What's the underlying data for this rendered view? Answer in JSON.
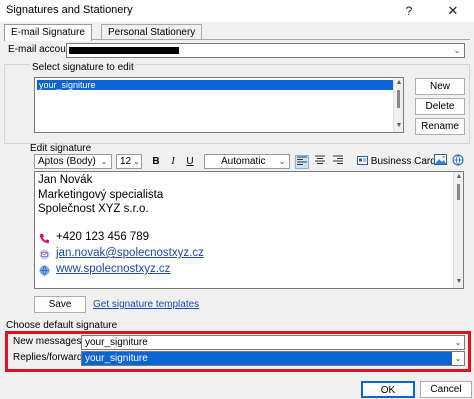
{
  "window": {
    "title": "Signatures and Stationery",
    "help": "?",
    "close": "✕"
  },
  "tabs": [
    {
      "label": "E-mail Signature",
      "active": true
    },
    {
      "label": "Personal Stationery",
      "active": false
    }
  ],
  "account": {
    "label": "E-mail account:"
  },
  "select_signature": {
    "label": "Select signature to edit",
    "items": [
      "your_signiture"
    ],
    "buttons": {
      "new": "New",
      "delete": "Delete",
      "rename": "Rename"
    }
  },
  "edit_signature": {
    "label": "Edit signature",
    "font": "Aptos (Body)",
    "size": "12",
    "bold": "B",
    "italic": "I",
    "underline": "U",
    "color": "Automatic",
    "business_card": "Business Card",
    "lines": {
      "name": "Jan Novák",
      "role": "Marketingový specialista",
      "company": "Společnost XYZ s.r.o.",
      "phone": "+420 123 456 789",
      "email": "jan.novak@spolecnostxyz.cz",
      "web": "www.spolecnostxyz.cz"
    }
  },
  "save": "Save",
  "templates_link": "Get signature templates",
  "default_signature": {
    "label": "Choose default signature",
    "new_messages_label": "New messages:",
    "new_messages_value": "your_signiture",
    "replies_label": "Replies/forwards:",
    "replies_value": "your_signiture"
  },
  "footer": {
    "ok": "OK",
    "cancel": "Cancel"
  },
  "colors": {
    "accent": "#0a64d4",
    "highlight": "#e3101e",
    "link": "#1a49a8",
    "phone": "#d0166e"
  }
}
